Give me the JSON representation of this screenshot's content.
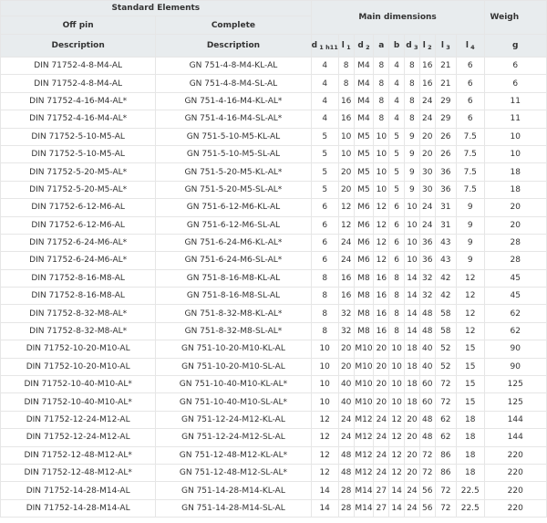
{
  "headers": {
    "standard_elements": "Standard Elements",
    "main_dimensions": "Main dimensions",
    "weight": "Weigh",
    "off_pin": "Off pin",
    "complete": "Complete",
    "description": "Description",
    "description2": "Description",
    "cols": [
      {
        "base": "d",
        "sub": "1 h11"
      },
      {
        "base": "l",
        "sub": "1"
      },
      {
        "base": "d",
        "sub": "2"
      },
      {
        "base": "a",
        "sub": ""
      },
      {
        "base": "b",
        "sub": ""
      },
      {
        "base": "d",
        "sub": "3"
      },
      {
        "base": "l",
        "sub": "2"
      },
      {
        "base": "l",
        "sub": "3"
      },
      {
        "base": "l",
        "sub": "4"
      },
      {
        "base": "g",
        "sub": ""
      }
    ]
  },
  "rows": [
    [
      "DIN 71752-4-8-M4-AL",
      "GN 751-4-8-M4-KL-AL",
      "4",
      "8",
      "M4",
      "8",
      "4",
      "8",
      "16",
      "21",
      "6",
      "6"
    ],
    [
      "DIN 71752-4-8-M4-AL",
      "GN 751-4-8-M4-SL-AL",
      "4",
      "8",
      "M4",
      "8",
      "4",
      "8",
      "16",
      "21",
      "6",
      "6"
    ],
    [
      "DIN 71752-4-16-M4-AL*",
      "GN 751-4-16-M4-KL-AL*",
      "4",
      "16",
      "M4",
      "8",
      "4",
      "8",
      "24",
      "29",
      "6",
      "11"
    ],
    [
      "DIN 71752-4-16-M4-AL*",
      "GN 751-4-16-M4-SL-AL*",
      "4",
      "16",
      "M4",
      "8",
      "4",
      "8",
      "24",
      "29",
      "6",
      "11"
    ],
    [
      "DIN 71752-5-10-M5-AL",
      "GN 751-5-10-M5-KL-AL",
      "5",
      "10",
      "M5",
      "10",
      "5",
      "9",
      "20",
      "26",
      "7.5",
      "10"
    ],
    [
      "DIN 71752-5-10-M5-AL",
      "GN 751-5-10-M5-SL-AL",
      "5",
      "10",
      "M5",
      "10",
      "5",
      "9",
      "20",
      "26",
      "7.5",
      "10"
    ],
    [
      "DIN 71752-5-20-M5-AL*",
      "GN 751-5-20-M5-KL-AL*",
      "5",
      "20",
      "M5",
      "10",
      "5",
      "9",
      "30",
      "36",
      "7.5",
      "18"
    ],
    [
      "DIN 71752-5-20-M5-AL*",
      "GN 751-5-20-M5-SL-AL*",
      "5",
      "20",
      "M5",
      "10",
      "5",
      "9",
      "30",
      "36",
      "7.5",
      "18"
    ],
    [
      "DIN 71752-6-12-M6-AL",
      "GN 751-6-12-M6-KL-AL",
      "6",
      "12",
      "M6",
      "12",
      "6",
      "10",
      "24",
      "31",
      "9",
      "20"
    ],
    [
      "DIN 71752-6-12-M6-AL",
      "GN 751-6-12-M6-SL-AL",
      "6",
      "12",
      "M6",
      "12",
      "6",
      "10",
      "24",
      "31",
      "9",
      "20"
    ],
    [
      "DIN 71752-6-24-M6-AL*",
      "GN 751-6-24-M6-KL-AL*",
      "6",
      "24",
      "M6",
      "12",
      "6",
      "10",
      "36",
      "43",
      "9",
      "28"
    ],
    [
      "DIN 71752-6-24-M6-AL*",
      "GN 751-6-24-M6-SL-AL*",
      "6",
      "24",
      "M6",
      "12",
      "6",
      "10",
      "36",
      "43",
      "9",
      "28"
    ],
    [
      "DIN 71752-8-16-M8-AL",
      "GN 751-8-16-M8-KL-AL",
      "8",
      "16",
      "M8",
      "16",
      "8",
      "14",
      "32",
      "42",
      "12",
      "45"
    ],
    [
      "DIN 71752-8-16-M8-AL",
      "GN 751-8-16-M8-SL-AL",
      "8",
      "16",
      "M8",
      "16",
      "8",
      "14",
      "32",
      "42",
      "12",
      "45"
    ],
    [
      "DIN 71752-8-32-M8-AL*",
      "GN 751-8-32-M8-KL-AL*",
      "8",
      "32",
      "M8",
      "16",
      "8",
      "14",
      "48",
      "58",
      "12",
      "62"
    ],
    [
      "DIN 71752-8-32-M8-AL*",
      "GN 751-8-32-M8-SL-AL*",
      "8",
      "32",
      "M8",
      "16",
      "8",
      "14",
      "48",
      "58",
      "12",
      "62"
    ],
    [
      "DIN 71752-10-20-M10-AL",
      "GN 751-10-20-M10-KL-AL",
      "10",
      "20",
      "M10",
      "20",
      "10",
      "18",
      "40",
      "52",
      "15",
      "90"
    ],
    [
      "DIN 71752-10-20-M10-AL",
      "GN 751-10-20-M10-SL-AL",
      "10",
      "20",
      "M10",
      "20",
      "10",
      "18",
      "40",
      "52",
      "15",
      "90"
    ],
    [
      "DIN 71752-10-40-M10-AL*",
      "GN 751-10-40-M10-KL-AL*",
      "10",
      "40",
      "M10",
      "20",
      "10",
      "18",
      "60",
      "72",
      "15",
      "125"
    ],
    [
      "DIN 71752-10-40-M10-AL*",
      "GN 751-10-40-M10-SL-AL*",
      "10",
      "40",
      "M10",
      "20",
      "10",
      "18",
      "60",
      "72",
      "15",
      "125"
    ],
    [
      "DIN 71752-12-24-M12-AL",
      "GN 751-12-24-M12-KL-AL",
      "12",
      "24",
      "M12",
      "24",
      "12",
      "20",
      "48",
      "62",
      "18",
      "144"
    ],
    [
      "DIN 71752-12-24-M12-AL",
      "GN 751-12-24-M12-SL-AL",
      "12",
      "24",
      "M12",
      "24",
      "12",
      "20",
      "48",
      "62",
      "18",
      "144"
    ],
    [
      "DIN 71752-12-48-M12-AL*",
      "GN 751-12-48-M12-KL-AL*",
      "12",
      "48",
      "M12",
      "24",
      "12",
      "20",
      "72",
      "86",
      "18",
      "220"
    ],
    [
      "DIN 71752-12-48-M12-AL*",
      "GN 751-12-48-M12-SL-AL*",
      "12",
      "48",
      "M12",
      "24",
      "12",
      "20",
      "72",
      "86",
      "18",
      "220"
    ],
    [
      "DIN 71752-14-28-M14-AL",
      "GN 751-14-28-M14-KL-AL",
      "14",
      "28",
      "M14",
      "27",
      "14",
      "24",
      "56",
      "72",
      "22.5",
      "220"
    ],
    [
      "DIN 71752-14-28-M14-AL",
      "GN 751-14-28-M14-SL-AL",
      "14",
      "28",
      "M14",
      "27",
      "14",
      "24",
      "56",
      "72",
      "22.5",
      "220"
    ]
  ]
}
